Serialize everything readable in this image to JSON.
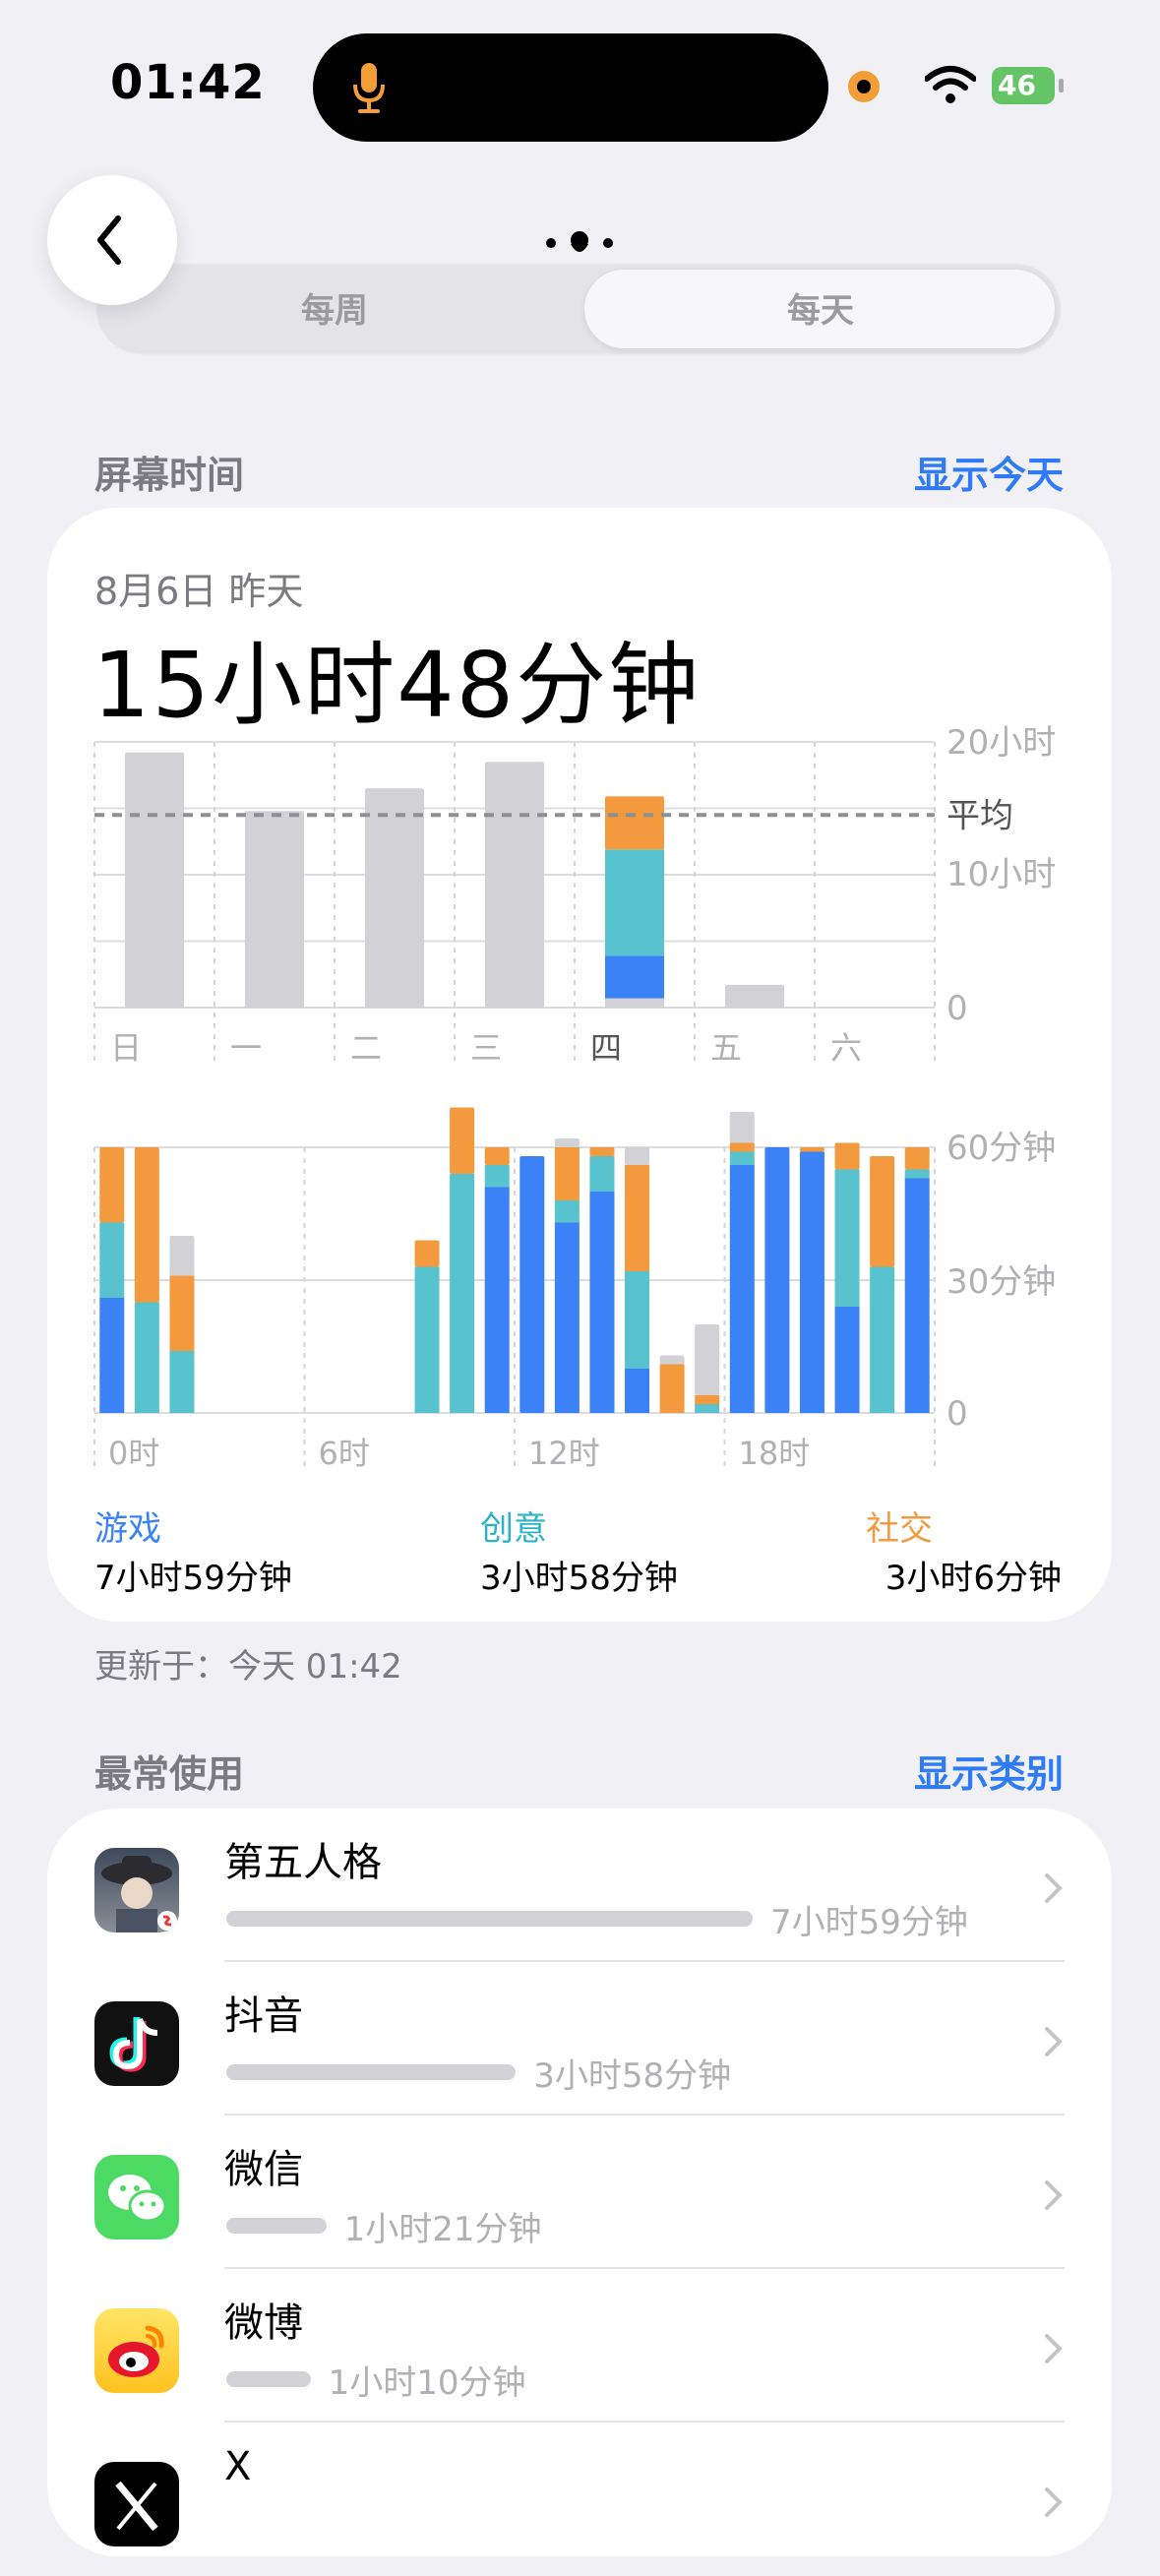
{
  "status": {
    "time": "01:42",
    "battery": "46"
  },
  "segments": [
    "每周",
    "每天"
  ],
  "screen_time": {
    "section_title": "屏幕时间",
    "show_today": "显示今天",
    "date": "8月6日 昨天",
    "total": "15小时48分钟"
  },
  "chart_data": [
    {
      "type": "bar",
      "title": "",
      "categories": [
        "日",
        "一",
        "二",
        "三",
        "四",
        "五",
        "六"
      ],
      "ylabels": [
        "20小时",
        "10小时",
        "0"
      ],
      "average_label": "平均",
      "ylim": [
        0,
        20
      ],
      "average": 14.5,
      "series": [
        {
          "name": "其他",
          "color": "#d1d1d6",
          "values": [
            19.2,
            14.8,
            16.5,
            18.5,
            0.7,
            1.7,
            0
          ]
        },
        {
          "name": "游戏",
          "color": "#3b82f6",
          "values": [
            0,
            0,
            0,
            0,
            3.2,
            0,
            0
          ]
        },
        {
          "name": "创意",
          "color": "#59c2cf",
          "values": [
            0,
            0,
            0,
            0,
            8.0,
            0,
            0
          ]
        },
        {
          "name": "社交",
          "color": "#f39a3e",
          "values": [
            0,
            0,
            0,
            0,
            4.0,
            0,
            0
          ]
        }
      ]
    },
    {
      "type": "bar",
      "title": "",
      "categories": [
        "0时",
        "1",
        "2",
        "3",
        "4",
        "5",
        "6时",
        "7",
        "8",
        "9",
        "10",
        "11",
        "12时",
        "13",
        "14",
        "15",
        "16",
        "17",
        "18时",
        "19",
        "20",
        "21",
        "22",
        "23"
      ],
      "xlabels": [
        "0时",
        "6时",
        "12时",
        "18时"
      ],
      "ylabels": [
        "60分钟",
        "30分钟",
        "0"
      ],
      "ylim": [
        0,
        60
      ],
      "series": [
        {
          "name": "游戏",
          "color": "#3b82f6",
          "values": [
            26,
            0,
            0,
            0,
            0,
            0,
            0,
            0,
            0,
            0,
            0,
            51,
            58,
            43,
            50,
            10,
            0,
            0,
            56,
            60,
            59,
            24,
            0,
            53
          ]
        },
        {
          "name": "创意",
          "color": "#59c2cf",
          "values": [
            17,
            25,
            14,
            0,
            0,
            0,
            0,
            0,
            0,
            33,
            54,
            5,
            0,
            5,
            8,
            22,
            0,
            2,
            3,
            0,
            0,
            31,
            33,
            2
          ]
        },
        {
          "name": "社交",
          "color": "#f39a3e",
          "values": [
            17,
            35,
            17,
            0,
            0,
            0,
            0,
            0,
            0,
            6,
            15,
            4,
            0,
            12,
            2,
            24,
            11,
            2,
            2,
            0,
            1,
            6,
            25,
            5
          ]
        },
        {
          "name": "其他",
          "color": "#d1d1d6",
          "values": [
            0,
            0,
            9,
            0,
            0,
            0,
            0,
            0,
            0,
            0,
            0,
            0,
            0,
            2,
            0,
            4,
            2,
            16,
            7,
            0,
            0,
            0,
            0,
            0
          ]
        }
      ]
    }
  ],
  "legend": [
    {
      "name": "游戏",
      "value": "7小时59分钟",
      "color": "#3b82f6"
    },
    {
      "name": "创意",
      "value": "3小时58分钟",
      "color": "#2bb3c9"
    },
    {
      "name": "社交",
      "value": "3小时6分钟",
      "color": "#f39a3e"
    }
  ],
  "updated": "更新于：今天 01:42",
  "most_used": {
    "title": "最常使用",
    "show_categories": "显示类别",
    "apps": [
      {
        "name": "第五人格",
        "time": "7小时59分钟",
        "icon": "identity-v-icon",
        "fraction": 1.0
      },
      {
        "name": "抖音",
        "time": "3小时58分钟",
        "icon": "douyin-icon",
        "fraction": 0.55
      },
      {
        "name": "微信",
        "time": "1小时21分钟",
        "icon": "wechat-icon",
        "fraction": 0.19
      },
      {
        "name": "微博",
        "time": "1小时10分钟",
        "icon": "weibo-icon",
        "fraction": 0.16
      },
      {
        "name": "X",
        "time": "",
        "icon": "x-icon",
        "fraction": 0
      }
    ]
  }
}
